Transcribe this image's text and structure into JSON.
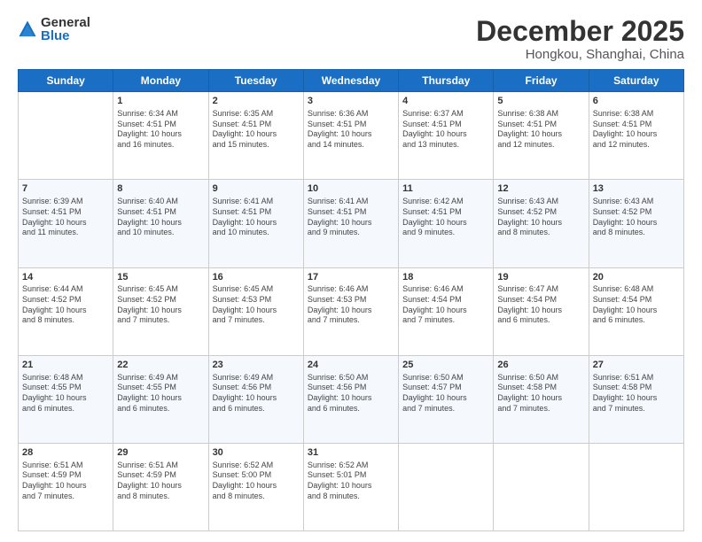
{
  "logo": {
    "general": "General",
    "blue": "Blue"
  },
  "header": {
    "title": "December 2025",
    "subtitle": "Hongkou, Shanghai, China"
  },
  "weekdays": [
    "Sunday",
    "Monday",
    "Tuesday",
    "Wednesday",
    "Thursday",
    "Friday",
    "Saturday"
  ],
  "weeks": [
    [
      {
        "day": "",
        "info": ""
      },
      {
        "day": "1",
        "info": "Sunrise: 6:34 AM\nSunset: 4:51 PM\nDaylight: 10 hours\nand 16 minutes."
      },
      {
        "day": "2",
        "info": "Sunrise: 6:35 AM\nSunset: 4:51 PM\nDaylight: 10 hours\nand 15 minutes."
      },
      {
        "day": "3",
        "info": "Sunrise: 6:36 AM\nSunset: 4:51 PM\nDaylight: 10 hours\nand 14 minutes."
      },
      {
        "day": "4",
        "info": "Sunrise: 6:37 AM\nSunset: 4:51 PM\nDaylight: 10 hours\nand 13 minutes."
      },
      {
        "day": "5",
        "info": "Sunrise: 6:38 AM\nSunset: 4:51 PM\nDaylight: 10 hours\nand 12 minutes."
      },
      {
        "day": "6",
        "info": "Sunrise: 6:38 AM\nSunset: 4:51 PM\nDaylight: 10 hours\nand 12 minutes."
      }
    ],
    [
      {
        "day": "7",
        "info": "Sunrise: 6:39 AM\nSunset: 4:51 PM\nDaylight: 10 hours\nand 11 minutes."
      },
      {
        "day": "8",
        "info": "Sunrise: 6:40 AM\nSunset: 4:51 PM\nDaylight: 10 hours\nand 10 minutes."
      },
      {
        "day": "9",
        "info": "Sunrise: 6:41 AM\nSunset: 4:51 PM\nDaylight: 10 hours\nand 10 minutes."
      },
      {
        "day": "10",
        "info": "Sunrise: 6:41 AM\nSunset: 4:51 PM\nDaylight: 10 hours\nand 9 minutes."
      },
      {
        "day": "11",
        "info": "Sunrise: 6:42 AM\nSunset: 4:51 PM\nDaylight: 10 hours\nand 9 minutes."
      },
      {
        "day": "12",
        "info": "Sunrise: 6:43 AM\nSunset: 4:52 PM\nDaylight: 10 hours\nand 8 minutes."
      },
      {
        "day": "13",
        "info": "Sunrise: 6:43 AM\nSunset: 4:52 PM\nDaylight: 10 hours\nand 8 minutes."
      }
    ],
    [
      {
        "day": "14",
        "info": "Sunrise: 6:44 AM\nSunset: 4:52 PM\nDaylight: 10 hours\nand 8 minutes."
      },
      {
        "day": "15",
        "info": "Sunrise: 6:45 AM\nSunset: 4:52 PM\nDaylight: 10 hours\nand 7 minutes."
      },
      {
        "day": "16",
        "info": "Sunrise: 6:45 AM\nSunset: 4:53 PM\nDaylight: 10 hours\nand 7 minutes."
      },
      {
        "day": "17",
        "info": "Sunrise: 6:46 AM\nSunset: 4:53 PM\nDaylight: 10 hours\nand 7 minutes."
      },
      {
        "day": "18",
        "info": "Sunrise: 6:46 AM\nSunset: 4:54 PM\nDaylight: 10 hours\nand 7 minutes."
      },
      {
        "day": "19",
        "info": "Sunrise: 6:47 AM\nSunset: 4:54 PM\nDaylight: 10 hours\nand 6 minutes."
      },
      {
        "day": "20",
        "info": "Sunrise: 6:48 AM\nSunset: 4:54 PM\nDaylight: 10 hours\nand 6 minutes."
      }
    ],
    [
      {
        "day": "21",
        "info": "Sunrise: 6:48 AM\nSunset: 4:55 PM\nDaylight: 10 hours\nand 6 minutes."
      },
      {
        "day": "22",
        "info": "Sunrise: 6:49 AM\nSunset: 4:55 PM\nDaylight: 10 hours\nand 6 minutes."
      },
      {
        "day": "23",
        "info": "Sunrise: 6:49 AM\nSunset: 4:56 PM\nDaylight: 10 hours\nand 6 minutes."
      },
      {
        "day": "24",
        "info": "Sunrise: 6:50 AM\nSunset: 4:56 PM\nDaylight: 10 hours\nand 6 minutes."
      },
      {
        "day": "25",
        "info": "Sunrise: 6:50 AM\nSunset: 4:57 PM\nDaylight: 10 hours\nand 7 minutes."
      },
      {
        "day": "26",
        "info": "Sunrise: 6:50 AM\nSunset: 4:58 PM\nDaylight: 10 hours\nand 7 minutes."
      },
      {
        "day": "27",
        "info": "Sunrise: 6:51 AM\nSunset: 4:58 PM\nDaylight: 10 hours\nand 7 minutes."
      }
    ],
    [
      {
        "day": "28",
        "info": "Sunrise: 6:51 AM\nSunset: 4:59 PM\nDaylight: 10 hours\nand 7 minutes."
      },
      {
        "day": "29",
        "info": "Sunrise: 6:51 AM\nSunset: 4:59 PM\nDaylight: 10 hours\nand 8 minutes."
      },
      {
        "day": "30",
        "info": "Sunrise: 6:52 AM\nSunset: 5:00 PM\nDaylight: 10 hours\nand 8 minutes."
      },
      {
        "day": "31",
        "info": "Sunrise: 6:52 AM\nSunset: 5:01 PM\nDaylight: 10 hours\nand 8 minutes."
      },
      {
        "day": "",
        "info": ""
      },
      {
        "day": "",
        "info": ""
      },
      {
        "day": "",
        "info": ""
      }
    ]
  ]
}
